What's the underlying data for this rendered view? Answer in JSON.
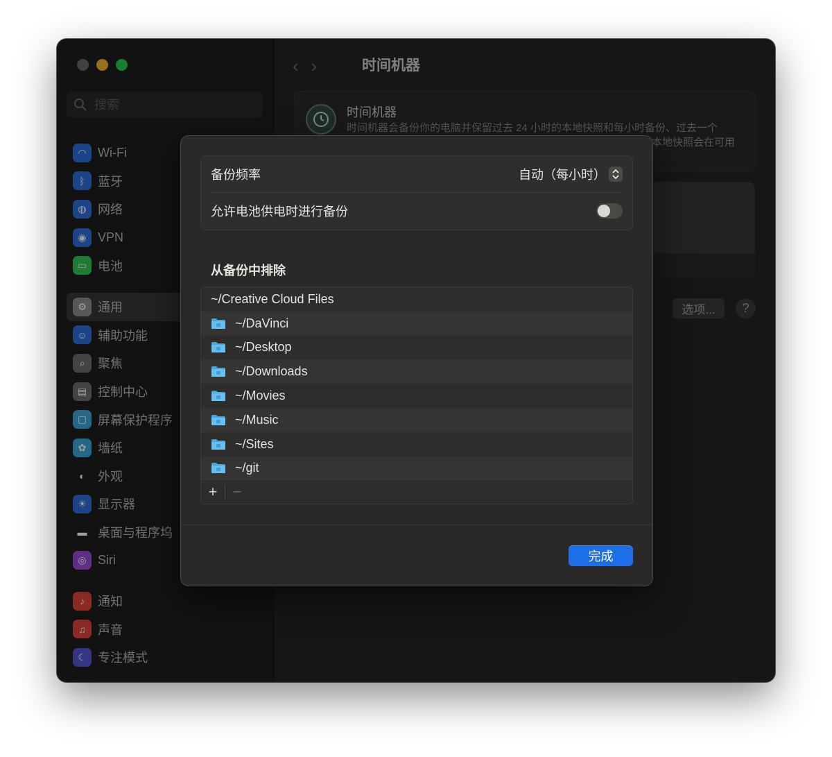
{
  "sidebar": {
    "search_placeholder": "搜索",
    "items": [
      {
        "label": "Wi-Fi",
        "icon": "wifi-icon",
        "color": "#2f6fd8"
      },
      {
        "label": "蓝牙",
        "icon": "bluetooth-icon",
        "color": "#2f6fd8"
      },
      {
        "label": "网络",
        "icon": "globe-icon",
        "color": "#2f6fd8"
      },
      {
        "label": "VPN",
        "icon": "vpn-icon",
        "color": "#2f6fd8"
      },
      {
        "label": "电池",
        "icon": "battery-icon",
        "color": "#34c759"
      },
      {
        "label": "通用",
        "icon": "gear-icon",
        "color": "#8e8e93"
      },
      {
        "label": "辅助功能",
        "icon": "accessibility-icon",
        "color": "#2f6fd8"
      },
      {
        "label": "聚焦",
        "icon": "spotlight-icon",
        "color": "#6e6e73"
      },
      {
        "label": "控制中心",
        "icon": "control-center-icon",
        "color": "#6e6e73"
      },
      {
        "label": "屏幕保护程序",
        "icon": "screensaver-icon",
        "color": "#3aa7d8"
      },
      {
        "label": "墙纸",
        "icon": "wallpaper-icon",
        "color": "#3aa7d8"
      },
      {
        "label": "外观",
        "icon": "appearance-icon",
        "color": "#1c1c1e"
      },
      {
        "label": "显示器",
        "icon": "display-icon",
        "color": "#2f6fd8"
      },
      {
        "label": "桌面与程序坞",
        "icon": "dock-icon",
        "color": "#1c1c1e"
      },
      {
        "label": "Siri",
        "icon": "siri-icon",
        "color": "#9b4dd6"
      },
      {
        "label": "通知",
        "icon": "bell-icon",
        "color": "#e0443a"
      },
      {
        "label": "声音",
        "icon": "speaker-icon",
        "color": "#e0443a"
      },
      {
        "label": "专注模式",
        "icon": "moon-icon",
        "color": "#5856d6"
      }
    ]
  },
  "main": {
    "title": "时间机器",
    "card": {
      "title": "时间机器",
      "description": "时间机器会备份你的电脑并保留过去 24 小时的本地快照和每小时备份、过去一个",
      "description_tail": "本地快照会在可用"
    },
    "options_label": "选项...",
    "help_label": "?"
  },
  "sheet": {
    "frequency_label": "备份频率",
    "frequency_value": "自动（每小时）",
    "battery_label": "允许电池供电时进行备份",
    "battery_enabled": false,
    "exclude_title": "从备份中排除",
    "excluded": [
      {
        "path": "~/Creative Cloud Files",
        "folder_icon": ""
      },
      {
        "path": "~/DaVinci",
        "folder_icon": "folder-icon"
      },
      {
        "path": "~/Desktop",
        "folder_icon": "desktop-folder-icon"
      },
      {
        "path": "~/Downloads",
        "folder_icon": "downloads-folder-icon"
      },
      {
        "path": "~/Movies",
        "folder_icon": "movies-folder-icon"
      },
      {
        "path": "~/Music",
        "folder_icon": "music-folder-icon"
      },
      {
        "path": "~/Sites",
        "folder_icon": "sites-folder-icon"
      },
      {
        "path": "~/git",
        "folder_icon": "git-folder-icon"
      }
    ],
    "add_label": "+",
    "remove_label": "−",
    "done_label": "完成",
    "accent": "#1c6fe6"
  }
}
